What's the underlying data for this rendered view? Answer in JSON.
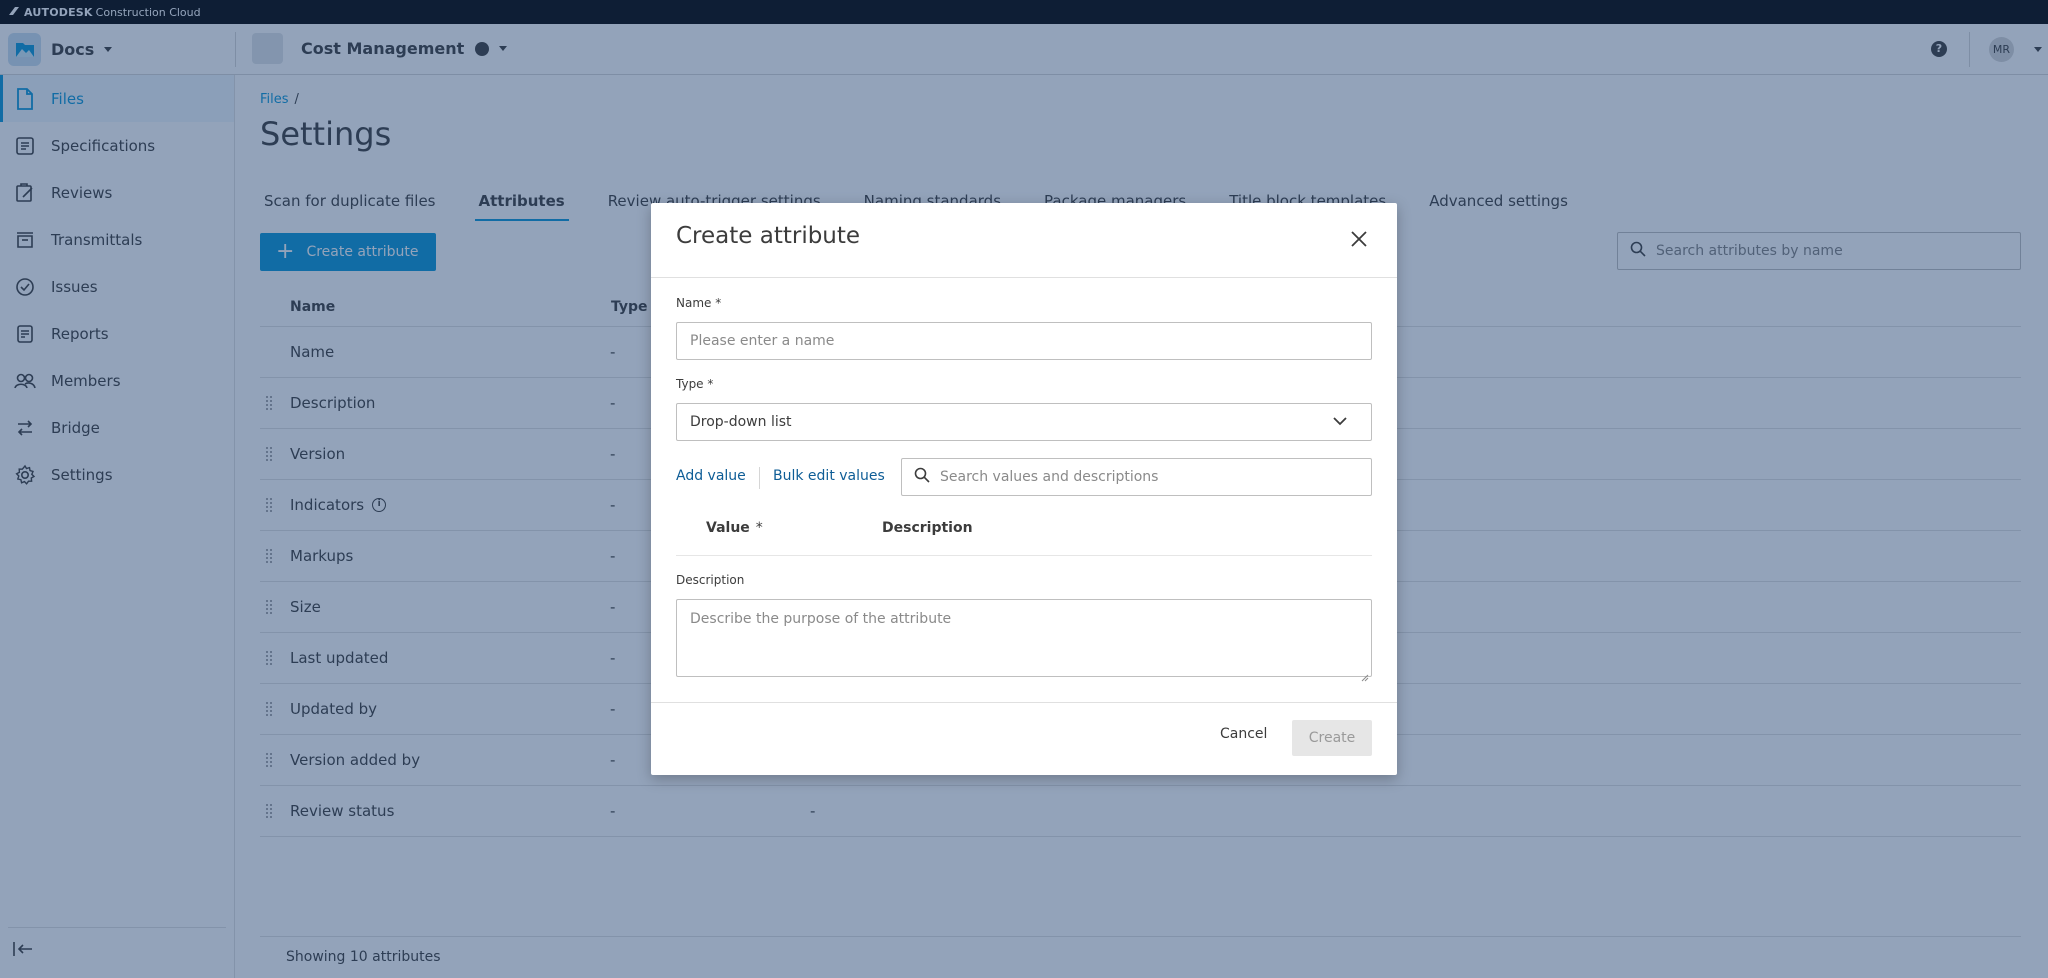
{
  "brand": {
    "name_bold": "AUTODESK",
    "name_rest": "Construction Cloud"
  },
  "header": {
    "app_name": "Docs",
    "project_name": "Cost Management",
    "help_icon": "question-circle-icon",
    "avatar_initials": "MR"
  },
  "sidebar": {
    "items": [
      {
        "label": "Files",
        "icon": "file-icon",
        "active": true
      },
      {
        "label": "Specifications",
        "icon": "specifications-icon"
      },
      {
        "label": "Reviews",
        "icon": "reviews-icon"
      },
      {
        "label": "Transmittals",
        "icon": "transmittals-icon"
      },
      {
        "label": "Issues",
        "icon": "issues-icon"
      },
      {
        "label": "Reports",
        "icon": "reports-icon"
      },
      {
        "label": "Members",
        "icon": "members-icon"
      },
      {
        "label": "Bridge",
        "icon": "bridge-icon"
      },
      {
        "label": "Settings",
        "icon": "gear-icon"
      }
    ]
  },
  "main": {
    "breadcrumb": {
      "link": "Files",
      "sep": "/"
    },
    "title": "Settings",
    "tabs": [
      {
        "label": "Scan for duplicate files"
      },
      {
        "label": "Attributes",
        "active": true
      },
      {
        "label": "Review auto-trigger settings"
      },
      {
        "label": "Naming standards"
      },
      {
        "label": "Package managers"
      },
      {
        "label": "Title block templates"
      },
      {
        "label": "Advanced settings"
      }
    ],
    "create_button": "Create attribute",
    "search_placeholder": "Search attributes by name",
    "table": {
      "headers": {
        "name": "Name",
        "type": "Type"
      },
      "rows": [
        {
          "name": "Name",
          "type": "-",
          "extra": ""
        },
        {
          "name": "Description",
          "type": "-",
          "extra": ""
        },
        {
          "name": "Version",
          "type": "-",
          "extra": ""
        },
        {
          "name": "Indicators",
          "type": "-",
          "extra": ""
        },
        {
          "name": "Markups",
          "type": "-",
          "extra": ""
        },
        {
          "name": "Size",
          "type": "-",
          "extra": ""
        },
        {
          "name": "Last updated",
          "type": "-",
          "extra": ""
        },
        {
          "name": "Updated by",
          "type": "-",
          "extra": ""
        },
        {
          "name": "Version added by",
          "type": "-",
          "extra": ""
        },
        {
          "name": "Review status",
          "type": "-",
          "extra": "-"
        }
      ]
    },
    "footer": "Showing 10 attributes"
  },
  "modal": {
    "title": "Create attribute",
    "name_label": "Name *",
    "name_placeholder": "Please enter a name",
    "type_label": "Type *",
    "type_value": "Drop-down list",
    "add_value": "Add value",
    "bulk_edit": "Bulk edit values",
    "values_search_placeholder": "Search values and descriptions",
    "col_value": "Value",
    "col_required": "*",
    "col_description": "Description",
    "description_label": "Description",
    "description_placeholder": "Describe the purpose of the attribute",
    "cancel": "Cancel",
    "create": "Create"
  },
  "colors": {
    "accent": "#0696d7",
    "overlay": "rgba(30,62,110,0.48)"
  }
}
